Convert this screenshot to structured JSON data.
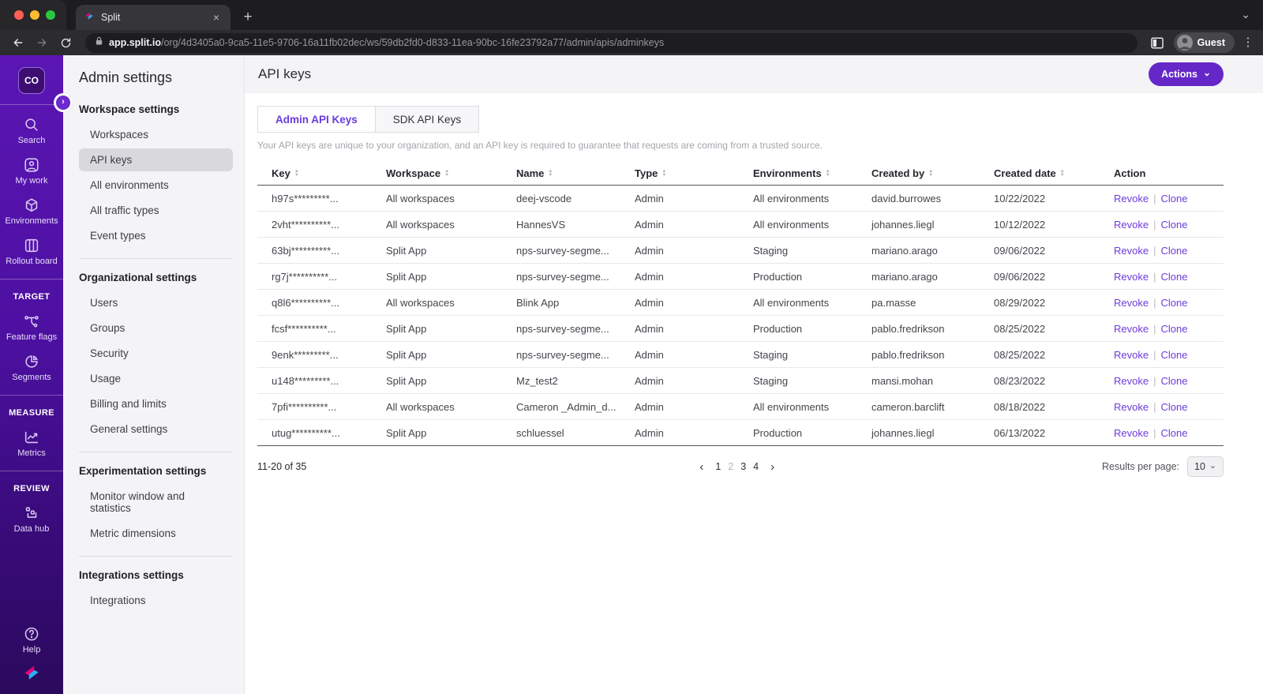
{
  "browser": {
    "tab_title": "Split",
    "url_host": "app.split.io",
    "url_path": "/org/4d3405a0-9ca5-11e5-9706-16a11fb02dec/ws/59db2fd0-d833-11ea-90bc-16fe23792a77/admin/apis/adminkeys",
    "profile_label": "Guest"
  },
  "rail": {
    "org_badge": "CO",
    "search": "Search",
    "my_work": "My work",
    "environments": "Environments",
    "rollout_board": "Rollout board",
    "section_target": "TARGET",
    "feature_flags": "Feature flags",
    "segments": "Segments",
    "section_measure": "MEASURE",
    "metrics": "Metrics",
    "section_review": "REVIEW",
    "data_hub": "Data hub",
    "help": "Help"
  },
  "admin_nav": {
    "title": "Admin settings",
    "groups": [
      {
        "heading": "Workspace settings",
        "items": [
          "Workspaces",
          "API keys",
          "All environments",
          "All traffic types",
          "Event types"
        ]
      },
      {
        "heading": "Organizational settings",
        "items": [
          "Users",
          "Groups",
          "Security",
          "Usage",
          "Billing and limits",
          "General settings"
        ]
      },
      {
        "heading": "Experimentation settings",
        "items": [
          "Monitor window and statistics",
          "Metric dimensions"
        ]
      },
      {
        "heading": "Integrations settings",
        "items": [
          "Integrations"
        ]
      }
    ],
    "active_item": "API keys"
  },
  "main": {
    "page_title": "API keys",
    "actions_button": "Actions",
    "tabs": [
      {
        "label": "Admin API Keys",
        "active": true
      },
      {
        "label": "SDK API Keys",
        "active": false
      }
    ],
    "description": "Your API keys are unique to your organization, and an API key is required to guarantee that requests are coming from a trusted source.",
    "table": {
      "columns": [
        "Key",
        "Workspace",
        "Name",
        "Type",
        "Environments",
        "Created by",
        "Created date",
        "Action"
      ],
      "revoke_label": "Revoke",
      "clone_label": "Clone",
      "action_separator": "|",
      "rows": [
        {
          "key": "h97s*********...",
          "workspace": "All workspaces",
          "name": "deej-vscode",
          "type": "Admin",
          "environments": "All environments",
          "created_by": "david.burrowes",
          "created_date": "10/22/2022"
        },
        {
          "key": "2vht**********...",
          "workspace": "All workspaces",
          "name": "HannesVS",
          "type": "Admin",
          "environments": "All environments",
          "created_by": "johannes.liegl",
          "created_date": "10/12/2022"
        },
        {
          "key": "63bj**********...",
          "workspace": "Split App",
          "name": "nps-survey-segme...",
          "type": "Admin",
          "environments": "Staging",
          "created_by": "mariano.arago",
          "created_date": "09/06/2022"
        },
        {
          "key": "rg7j**********...",
          "workspace": "Split App",
          "name": "nps-survey-segme...",
          "type": "Admin",
          "environments": "Production",
          "created_by": "mariano.arago",
          "created_date": "09/06/2022"
        },
        {
          "key": "q8l6**********...",
          "workspace": "All workspaces",
          "name": "Blink App",
          "type": "Admin",
          "environments": "All environments",
          "created_by": "pa.masse",
          "created_date": "08/29/2022"
        },
        {
          "key": "fcsf**********...",
          "workspace": "Split App",
          "name": "nps-survey-segme...",
          "type": "Admin",
          "environments": "Production",
          "created_by": "pablo.fredrikson",
          "created_date": "08/25/2022"
        },
        {
          "key": "9enk*********...",
          "workspace": "Split App",
          "name": "nps-survey-segme...",
          "type": "Admin",
          "environments": "Staging",
          "created_by": "pablo.fredrikson",
          "created_date": "08/25/2022"
        },
        {
          "key": "u148*********...",
          "workspace": "Split App",
          "name": "Mz_test2",
          "type": "Admin",
          "environments": "Staging",
          "created_by": "mansi.mohan",
          "created_date": "08/23/2022"
        },
        {
          "key": "7pfi**********...",
          "workspace": "All workspaces",
          "name": "Cameron _Admin_d...",
          "type": "Admin",
          "environments": "All environments",
          "created_by": "cameron.barclift",
          "created_date": "08/18/2022"
        },
        {
          "key": "utug**********...",
          "workspace": "Split App",
          "name": "schluessel",
          "type": "Admin",
          "environments": "Production",
          "created_by": "johannes.liegl",
          "created_date": "06/13/2022"
        }
      ]
    },
    "footer": {
      "range": "11-20 of 35",
      "pages": [
        "1",
        "2",
        "3",
        "4"
      ],
      "current_page": "2",
      "results_per_page_label": "Results per page:",
      "results_per_page_value": "10"
    }
  },
  "colors": {
    "accent_purple": "#6527c8",
    "link_purple": "#6e3bdb",
    "rail_gradient_top": "#5b16b4",
    "rail_gradient_bottom": "#2b0a5c"
  }
}
